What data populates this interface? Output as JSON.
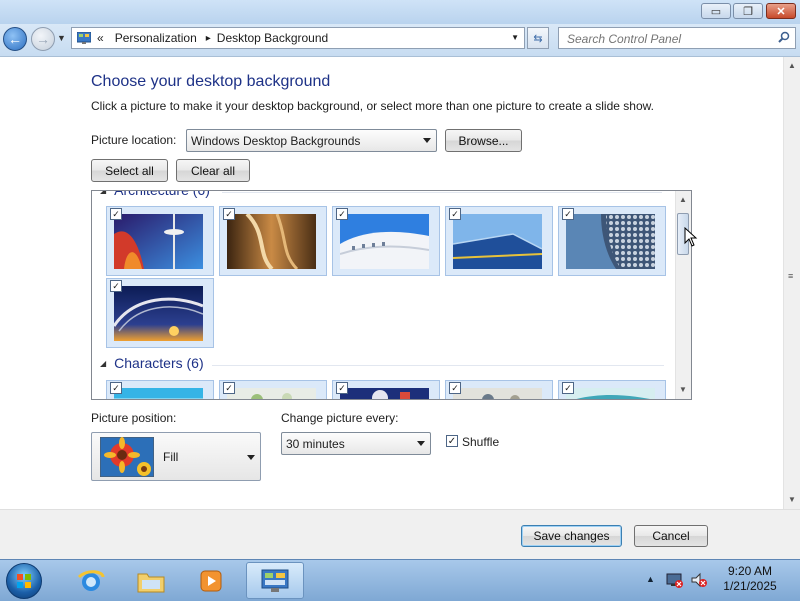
{
  "window": {
    "minimize_glyph": "▭",
    "maximize_glyph": "❐",
    "close_glyph": "✕"
  },
  "nav": {
    "back_glyph": "←",
    "forward_glyph": "→",
    "breadcrumb_chevron": "«",
    "breadcrumb": [
      "Personalization",
      "Desktop Background"
    ],
    "separator": "▸",
    "search_placeholder": "Search Control Panel"
  },
  "page": {
    "heading": "Choose your desktop background",
    "subtext": "Click a picture to make it your desktop background, or select more than one picture to create a slide show.",
    "picture_location_label": "Picture location:",
    "picture_location_value": "Windows Desktop Backgrounds",
    "browse_label": "Browse...",
    "select_all_label": "Select all",
    "clear_all_label": "Clear all"
  },
  "gallery": {
    "groups": [
      {
        "title": "Architecture (6)",
        "checked": [
          true,
          true,
          true,
          true,
          true,
          true
        ]
      },
      {
        "title": "Characters (6)",
        "checked": [
          true,
          true,
          true,
          true,
          true,
          true
        ]
      }
    ],
    "check_glyph": "✓"
  },
  "options": {
    "picture_position_label": "Picture position:",
    "picture_position_value": "Fill",
    "change_every_label": "Change picture every:",
    "change_every_value": "30 minutes",
    "shuffle_label": "Shuffle",
    "shuffle_checked": true
  },
  "actions": {
    "save_label": "Save changes",
    "cancel_label": "Cancel"
  },
  "taskbar": {
    "time": "9:20 AM",
    "date": "1/21/2025"
  },
  "colors": {
    "heading": "#1e3287",
    "accent": "#3399ff"
  }
}
